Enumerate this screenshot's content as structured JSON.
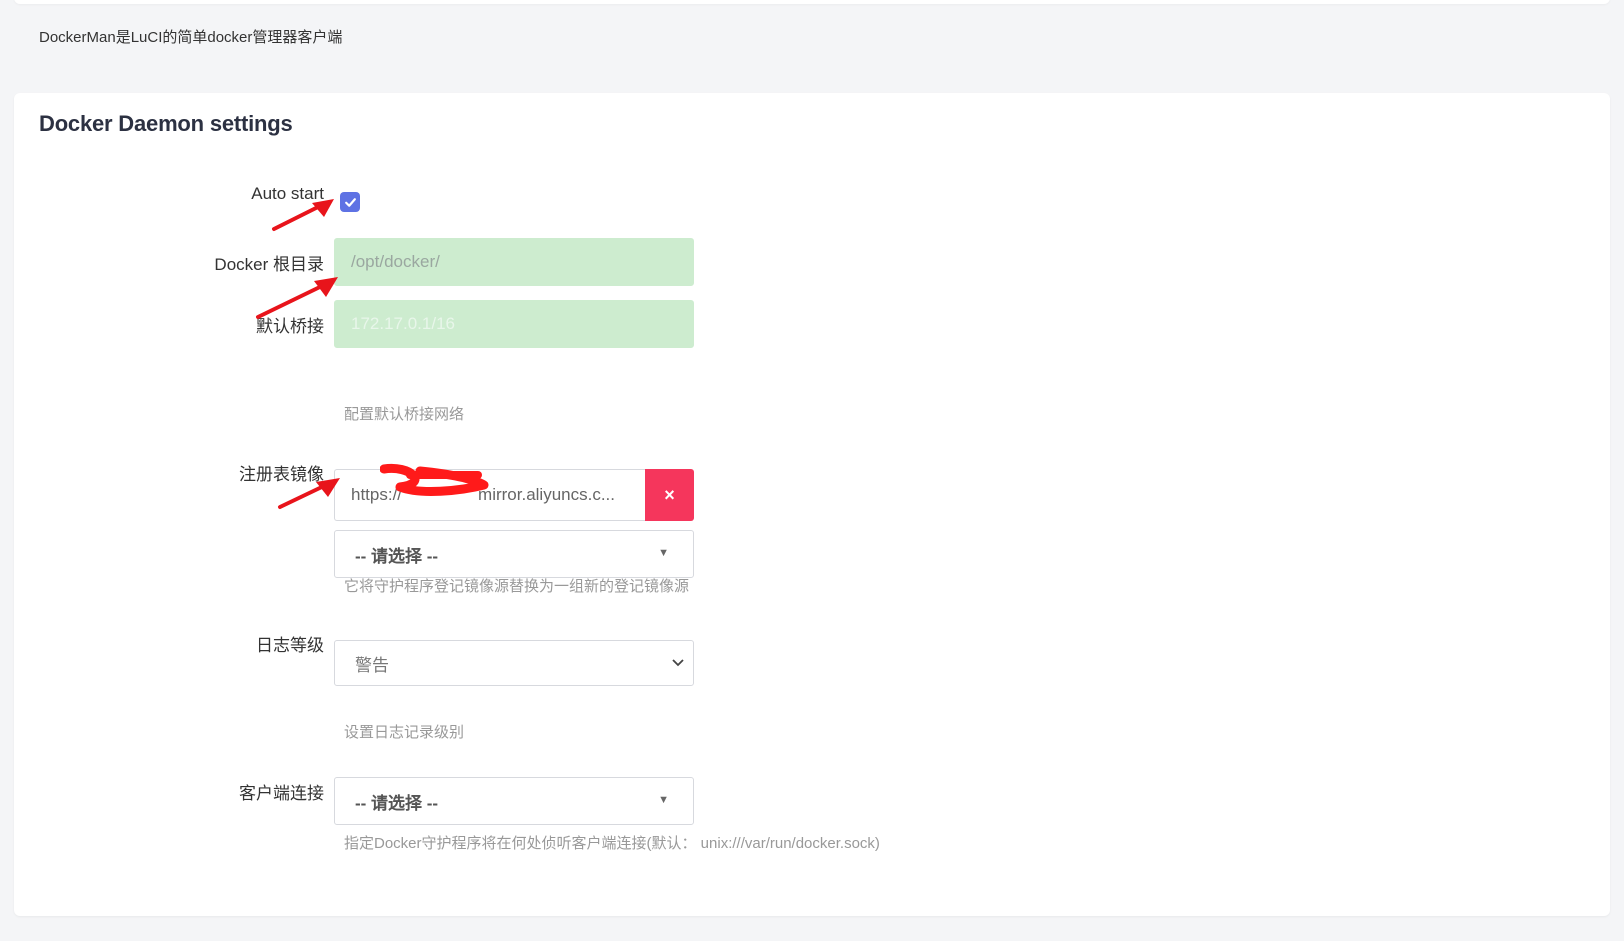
{
  "intro_text": "DockerMan是LuCI的简单docker管理器客户端",
  "section": {
    "title": "Docker Daemon settings"
  },
  "fields": {
    "auto_start": {
      "label": "Auto start",
      "checked": true
    },
    "docker_root": {
      "label": "Docker 根目录",
      "value": "/opt/docker/"
    },
    "default_bridge": {
      "label": "默认桥接",
      "value": "172.17.0.1/16",
      "hint": "配置默认桥接网络"
    },
    "registry_mirror": {
      "label": "注册表镜像",
      "value": "https://mirror.aliyuncs.c...",
      "value_prefix": "https://",
      "value_suffix": "mirror.aliyuncs.c...",
      "remove_label": "×",
      "select_placeholder": "-- 请选择 --",
      "hint": "它将守护程序登记镜像源替换为一组新的登记镜像源"
    },
    "log_level": {
      "label": "日志等级",
      "value": "警告",
      "hint": "设置日志记录级别"
    },
    "client_connection": {
      "label": "客户端连接",
      "select_placeholder": "-- 请选择 --",
      "hint": "指定Docker守护程序将在何处侦听客户端连接(默认： unix:///var/run/docker.sock)"
    }
  },
  "colors": {
    "accent": "#5e72e4",
    "danger": "#f5365c",
    "readonly_field": "#cdeccf",
    "annotation_arrow": "#e8141b"
  },
  "icons": {
    "checkbox": "check-icon",
    "remove": "close-icon",
    "dropdown": "caret-down-icon",
    "log_select": "chevron-down-icon"
  }
}
